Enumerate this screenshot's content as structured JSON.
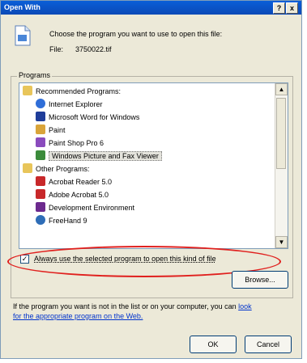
{
  "window": {
    "title": "Open With",
    "help_btn": "?",
    "close_btn": "x"
  },
  "header": {
    "prompt": "Choose the program you want to use to open this file:",
    "file_label": "File:",
    "file_name": "3750022.tif"
  },
  "programs": {
    "group_label": "Programs",
    "recommended_label": "Recommended Programs:",
    "recommended": [
      {
        "label": "Internet Explorer",
        "icon": "internet-explorer-icon",
        "color": "#2f6ed8"
      },
      {
        "label": "Microsoft Word for Windows",
        "icon": "word-icon",
        "color": "#1f3d9a"
      },
      {
        "label": "Paint",
        "icon": "paint-icon",
        "color": "#d9a43a"
      },
      {
        "label": "Paint Shop Pro 6",
        "icon": "paint-shop-pro-icon",
        "color": "#8a4bbd"
      },
      {
        "label": "Windows Picture and Fax Viewer",
        "icon": "picture-viewer-icon",
        "color": "#3b8b3b"
      }
    ],
    "other_label": "Other Programs:",
    "other": [
      {
        "label": "Acrobat Reader 5.0",
        "icon": "acrobat-reader-icon",
        "color": "#c8282a"
      },
      {
        "label": "Adobe Acrobat 5.0",
        "icon": "adobe-acrobat-icon",
        "color": "#c8282a"
      },
      {
        "label": "Development Environment",
        "icon": "dev-env-icon",
        "color": "#6c2a8e"
      },
      {
        "label": "FreeHand 9",
        "icon": "freehand-icon",
        "color": "#2e6db7"
      }
    ]
  },
  "always_checkbox": {
    "label": "Always use the selected program to open this kind of file",
    "checked": true
  },
  "browse_label": "Browse...",
  "footer": {
    "text": "If the program you want is not in the list or on your computer, you can",
    "link_1": "look",
    "link_2": "for the appropriate program on the Web."
  },
  "ok_label": "OK",
  "cancel_label": "Cancel",
  "colors": {
    "titlebar": "#0b52c6",
    "dialog_bg": "#ece9d8",
    "highlight_ellipse": "#e0201e",
    "link": "#0033cc"
  }
}
